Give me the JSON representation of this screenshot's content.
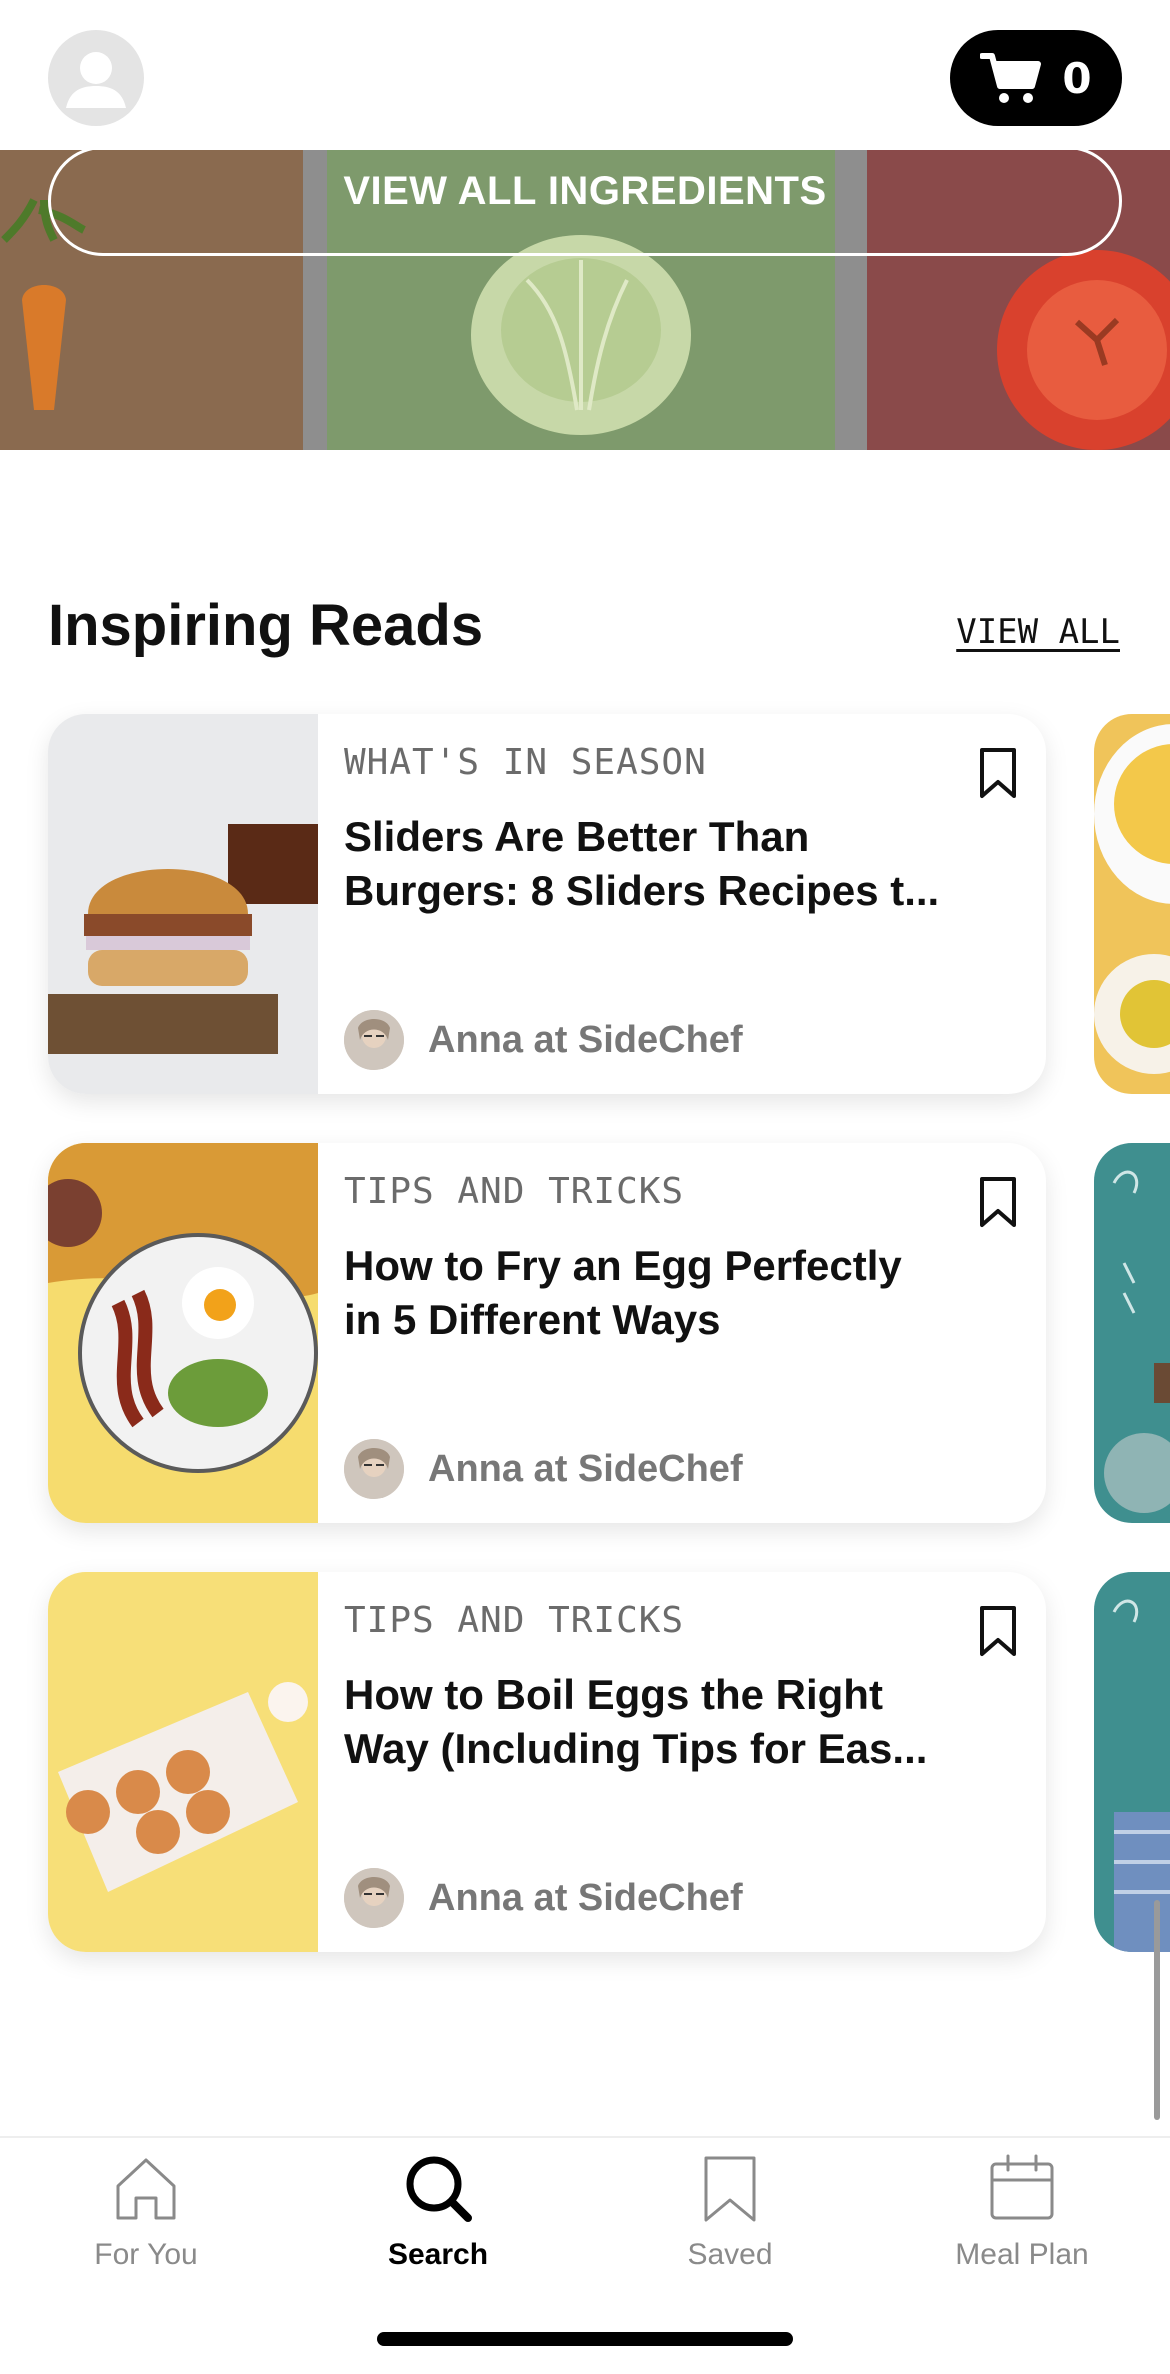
{
  "header": {
    "cart_count": "0"
  },
  "banner": {
    "button_label": "VIEW ALL INGREDIENTS"
  },
  "section": {
    "title": "Inspiring Reads",
    "view_all": "VIEW ALL"
  },
  "articles": [
    {
      "tag": "WHAT'S IN SEASON",
      "title_line1": "Sliders Are Better Than",
      "title_line2": "Burgers: 8 Sliders Recipes t...",
      "author": "Anna at SideChef",
      "image": "burger-slider"
    },
    {
      "tag": "TIPS AND TRICKS",
      "title_line1": "How to Fry an Egg Perfectly",
      "title_line2": "in 5 Different Ways",
      "author": "Anna at SideChef",
      "image": "fried-egg-plate"
    },
    {
      "tag": "TIPS AND TRICKS",
      "title_line1": "How to Boil Eggs the Right",
      "title_line2": "Way (Including Tips for Eas...",
      "author": "Anna at SideChef",
      "image": "eggs-carton"
    }
  ],
  "tabs": [
    {
      "label": "For You",
      "icon": "home-icon",
      "active": false
    },
    {
      "label": "Search",
      "icon": "search-icon",
      "active": true
    },
    {
      "label": "Saved",
      "icon": "bookmark-icon",
      "active": false
    },
    {
      "label": "Meal Plan",
      "icon": "calendar-icon",
      "active": false
    }
  ],
  "colors": {
    "accent": "#000000",
    "muted_text": "#777777",
    "banner_carrot": "#8a6a4f",
    "banner_cabbage": "#7e9a6c",
    "banner_tomato": "#8a4a4a"
  }
}
